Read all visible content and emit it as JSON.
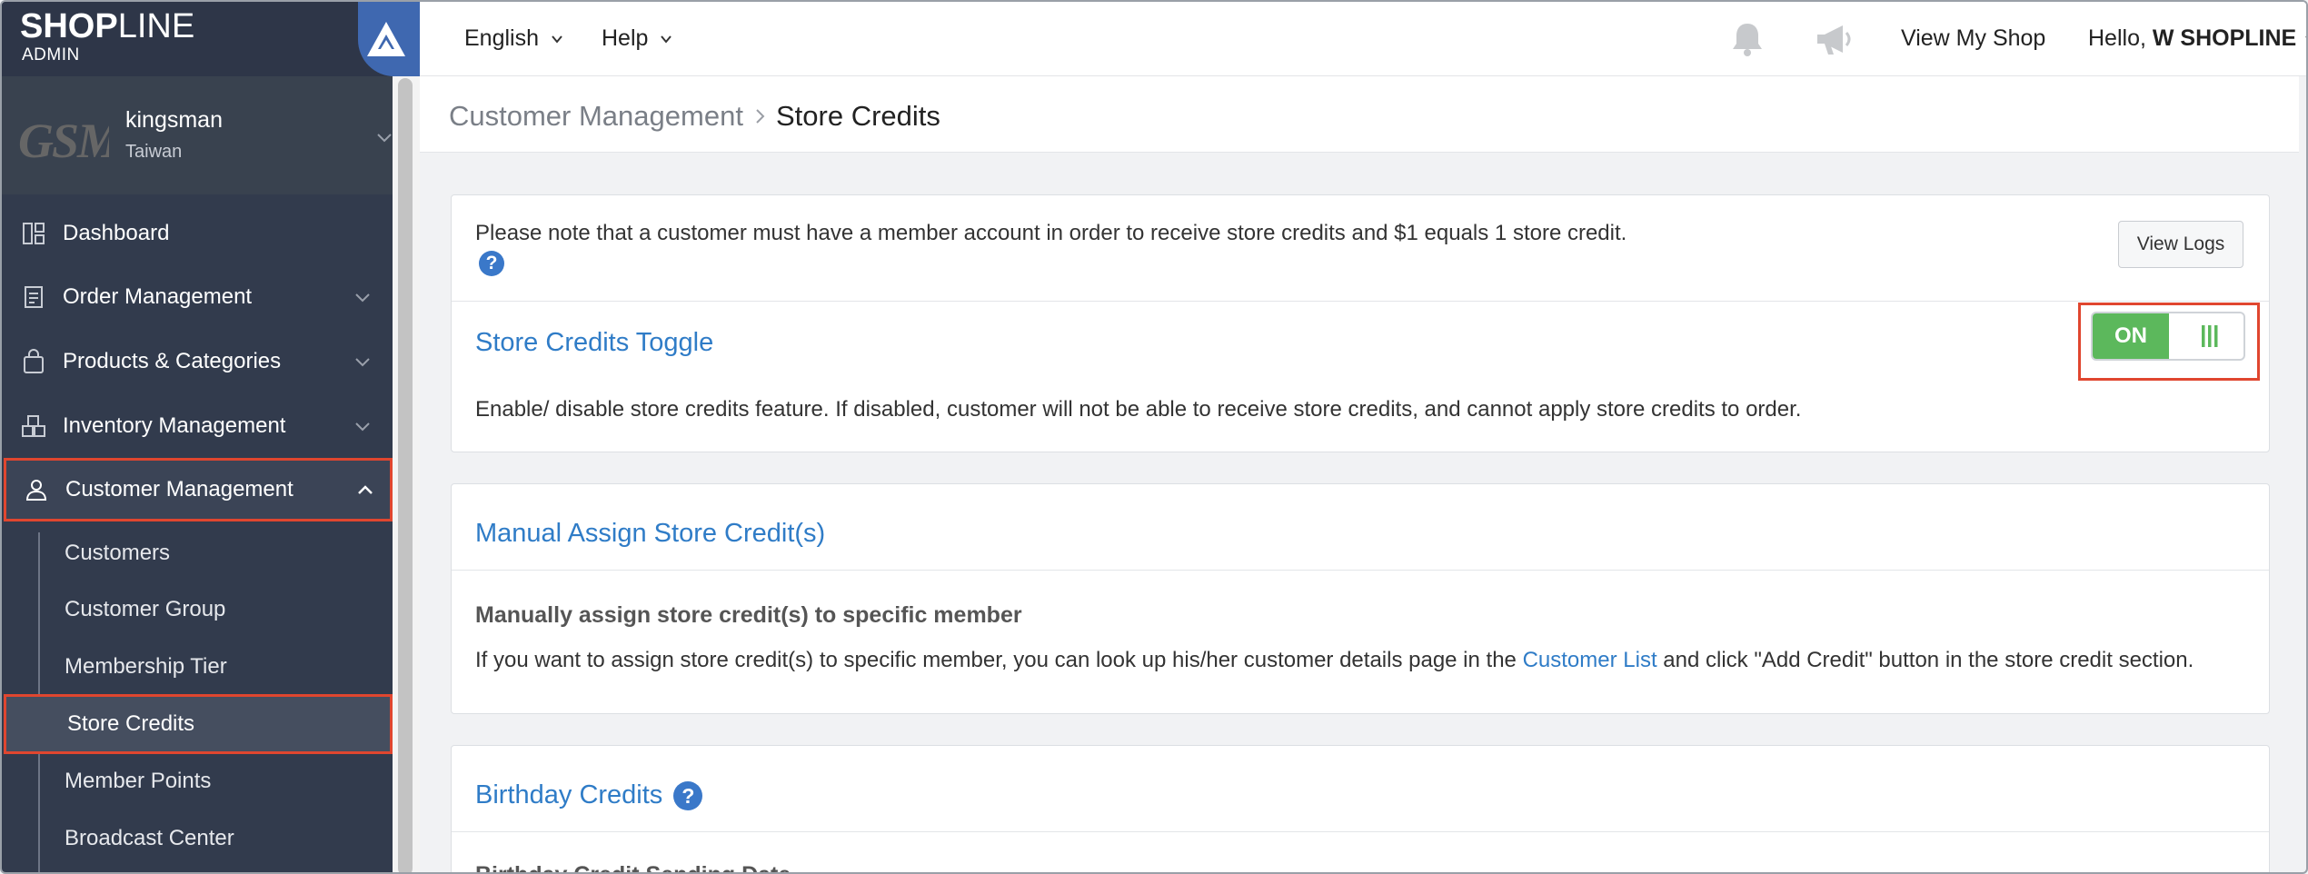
{
  "brand": {
    "name_bold": "SHOP",
    "name_thin": "LINE",
    "sub": "ADMIN"
  },
  "store": {
    "logo_text": "GSM",
    "name": "kingsman",
    "region": "Taiwan"
  },
  "sidebar": {
    "items": [
      {
        "label": "Dashboard",
        "icon": "dashboard-icon"
      },
      {
        "label": "Order Management",
        "icon": "clipboard-icon"
      },
      {
        "label": "Products & Categories",
        "icon": "shopping-bag-icon"
      },
      {
        "label": "Inventory Management",
        "icon": "boxes-icon"
      },
      {
        "label": "Customer Management",
        "icon": "user-icon",
        "active": true
      }
    ],
    "sub_items": [
      {
        "label": "Customers"
      },
      {
        "label": "Customer Group"
      },
      {
        "label": "Membership Tier"
      },
      {
        "label": "Store Credits",
        "active": true
      },
      {
        "label": "Member Points"
      },
      {
        "label": "Broadcast Center"
      }
    ]
  },
  "topbar": {
    "language": "English",
    "help": "Help",
    "view_shop": "View My Shop",
    "greeting": "Hello,",
    "user": "W SHOPLINE"
  },
  "breadcrumb": {
    "parent": "Customer Management",
    "current": "Store Credits"
  },
  "notice": {
    "text": "Please note that a customer must have a member account in order to receive store credits and $1 equals 1 store credit.",
    "view_logs": "View Logs"
  },
  "toggle_section": {
    "title": "Store Credits Toggle",
    "state": "ON",
    "description": "Enable/ disable store credits feature. If disabled, customer will not be able to receive store credits, and cannot apply store credits to order."
  },
  "manual_section": {
    "title": "Manual Assign Store Credit(s)",
    "heading": "Manually assign store credit(s) to specific member",
    "desc_before": "If you want to assign store credit(s) to specific member, you can look up his/her customer details page in the ",
    "link": "Customer List",
    "desc_after": " and click \"Add Credit\" button in the store credit section."
  },
  "birthday_section": {
    "title": "Birthday Credits",
    "heading": "Birthday Credit Sending Date"
  },
  "colors": {
    "sidebar": "#323b4d",
    "accent_blue": "#2f7cc7",
    "toggle_green": "#5cb85c",
    "highlight": "#e0462f"
  }
}
